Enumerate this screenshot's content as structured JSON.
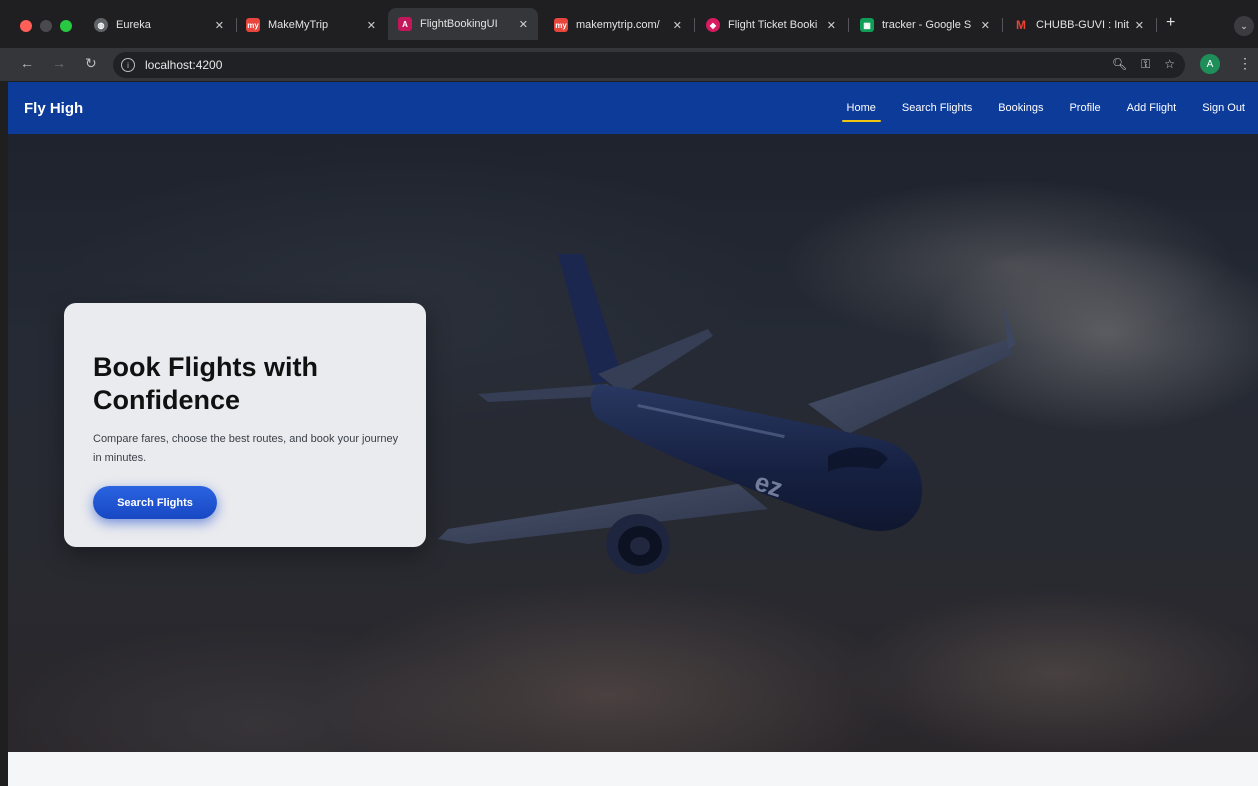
{
  "browser": {
    "tabs": [
      {
        "title": "Eureka",
        "favicon_color": "#5f6368",
        "favicon_glyph": "globe-icon"
      },
      {
        "title": "MakeMyTrip",
        "favicon_color": "#e8453c",
        "favicon_glyph": "my"
      },
      {
        "title": "FlightBookingUI",
        "favicon_color": "#c2185b",
        "favicon_glyph": "angular-icon"
      },
      {
        "title": "makemytrip.com/",
        "favicon_color": "#e8453c",
        "favicon_glyph": "my"
      },
      {
        "title": "Flight Ticket Booki",
        "favicon_color": "#d81b60",
        "favicon_glyph": "gem-icon"
      },
      {
        "title": "tracker - Google S",
        "favicon_color": "#0f9d58",
        "favicon_glyph": "sheets-icon"
      },
      {
        "title": "CHUBB-GUVI : Init",
        "favicon_color": "#ea4335",
        "favicon_glyph": "gmail-icon"
      }
    ],
    "active_tab": 2,
    "url": "localhost:4200",
    "profile_initial": "A"
  },
  "app": {
    "brand": "Fly High",
    "nav": [
      "Home",
      "Search Flights",
      "Bookings",
      "Profile",
      "Add Flight",
      "Sign Out"
    ],
    "active_nav": 0
  },
  "hero": {
    "heading": "Book Flights with Confidence",
    "subtext": "Compare fares, choose the best routes, and book your journey in minutes.",
    "cta_label": "Search Flights",
    "accent_color": "#1f56d4",
    "nav_color": "#0d3b9a",
    "tail_logo": "ez"
  }
}
